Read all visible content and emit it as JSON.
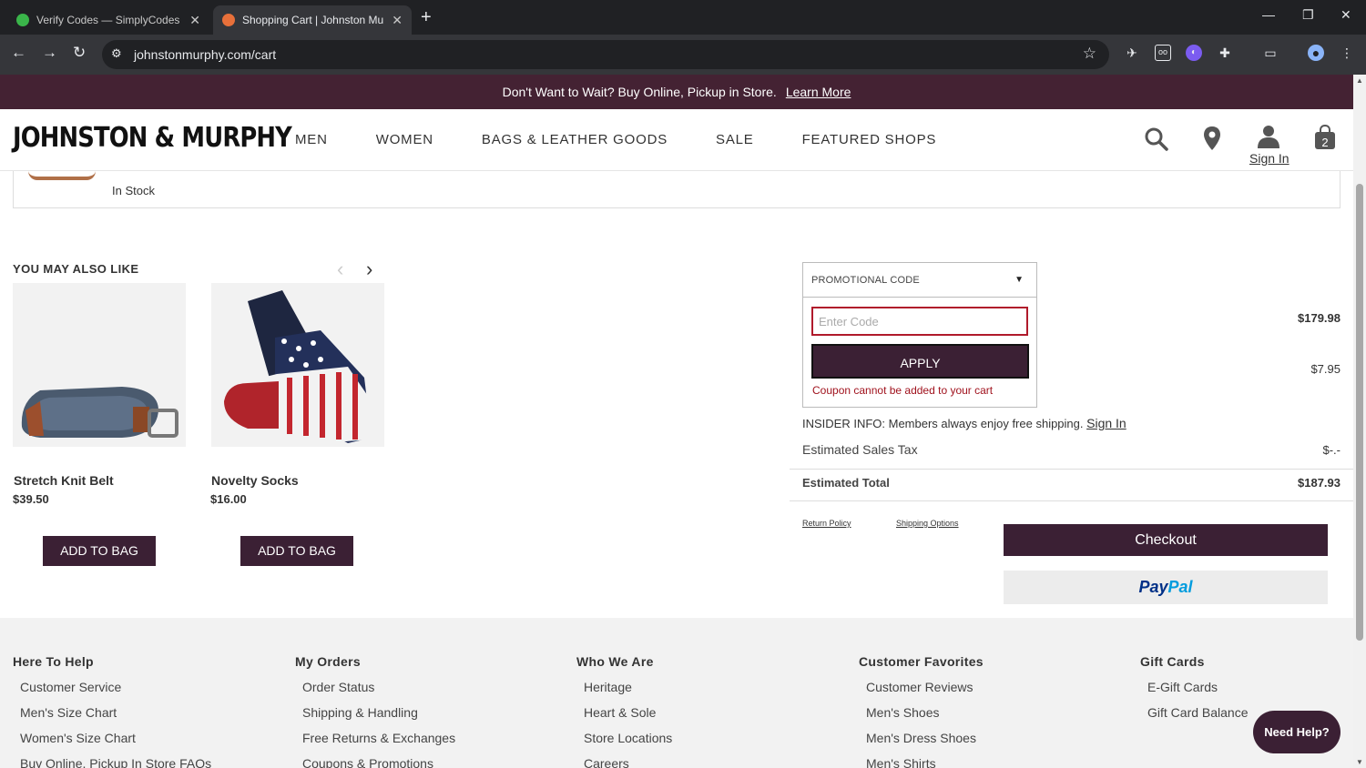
{
  "browser": {
    "tabs": [
      {
        "title": "Verify Codes — SimplyCodes",
        "active": false,
        "favicon_color": "#3ab54a"
      },
      {
        "title": "Shopping Cart | Johnston Murp",
        "active": true,
        "favicon_color": "#e8703a"
      }
    ],
    "url": "johnstonmurphy.com/cart"
  },
  "promo_bar": {
    "text": "Don't Want to Wait? Buy Online, Pickup in Store.",
    "link": "Learn More"
  },
  "header": {
    "logo": "JOHNSTON & MURPHY",
    "nav": [
      "MEN",
      "WOMEN",
      "BAGS & LEATHER GOODS",
      "SALE",
      "FEATURED SHOPS"
    ],
    "signin": "Sign In",
    "cart_count": "2"
  },
  "cart_item": {
    "stock": "In Stock"
  },
  "recommendations": {
    "title": "YOU MAY ALSO LIKE",
    "products": [
      {
        "name": "Stretch Knit Belt",
        "price": "$39.50",
        "button": "ADD TO BAG"
      },
      {
        "name": "Novelty Socks",
        "price": "$16.00",
        "button": "ADD TO BAG"
      }
    ]
  },
  "promo": {
    "header": "PROMOTIONAL CODE",
    "placeholder": "Enter Code",
    "apply": "APPLY",
    "error": "Coupon cannot be added to your cart"
  },
  "summary": {
    "subtotal": "$179.98",
    "shipping": "$7.95",
    "insider_text": "INSIDER INFO: Members always enjoy free shipping.",
    "insider_link": "Sign In",
    "tax_label": "Estimated Sales Tax",
    "tax_value": "$-.-",
    "total_label": "Estimated Total",
    "total_value": "$187.93",
    "return_policy": "Return Policy",
    "shipping_options": "Shipping Options",
    "checkout": "Checkout",
    "paypal_a": "Pay",
    "paypal_b": "Pal"
  },
  "footer": {
    "columns": [
      {
        "title": "Here To Help",
        "links": [
          "Customer Service",
          "Men's Size Chart",
          "Women's Size Chart",
          "Buy Online, Pickup In Store FAQs"
        ]
      },
      {
        "title": "My Orders",
        "links": [
          "Order Status",
          "Shipping & Handling",
          "Free Returns & Exchanges",
          "Coupons & Promotions"
        ]
      },
      {
        "title": "Who We Are",
        "links": [
          "Heritage",
          "Heart & Sole",
          "Store Locations",
          "Careers"
        ]
      },
      {
        "title": "Customer Favorites",
        "links": [
          "Customer Reviews",
          "Men's Shoes",
          "Men's Dress Shoes",
          "Men's Shirts"
        ]
      },
      {
        "title": "Gift Cards",
        "links": [
          "E-Gift Cards",
          "Gift Card Balance"
        ]
      }
    ],
    "need_help": "Need Help?"
  }
}
